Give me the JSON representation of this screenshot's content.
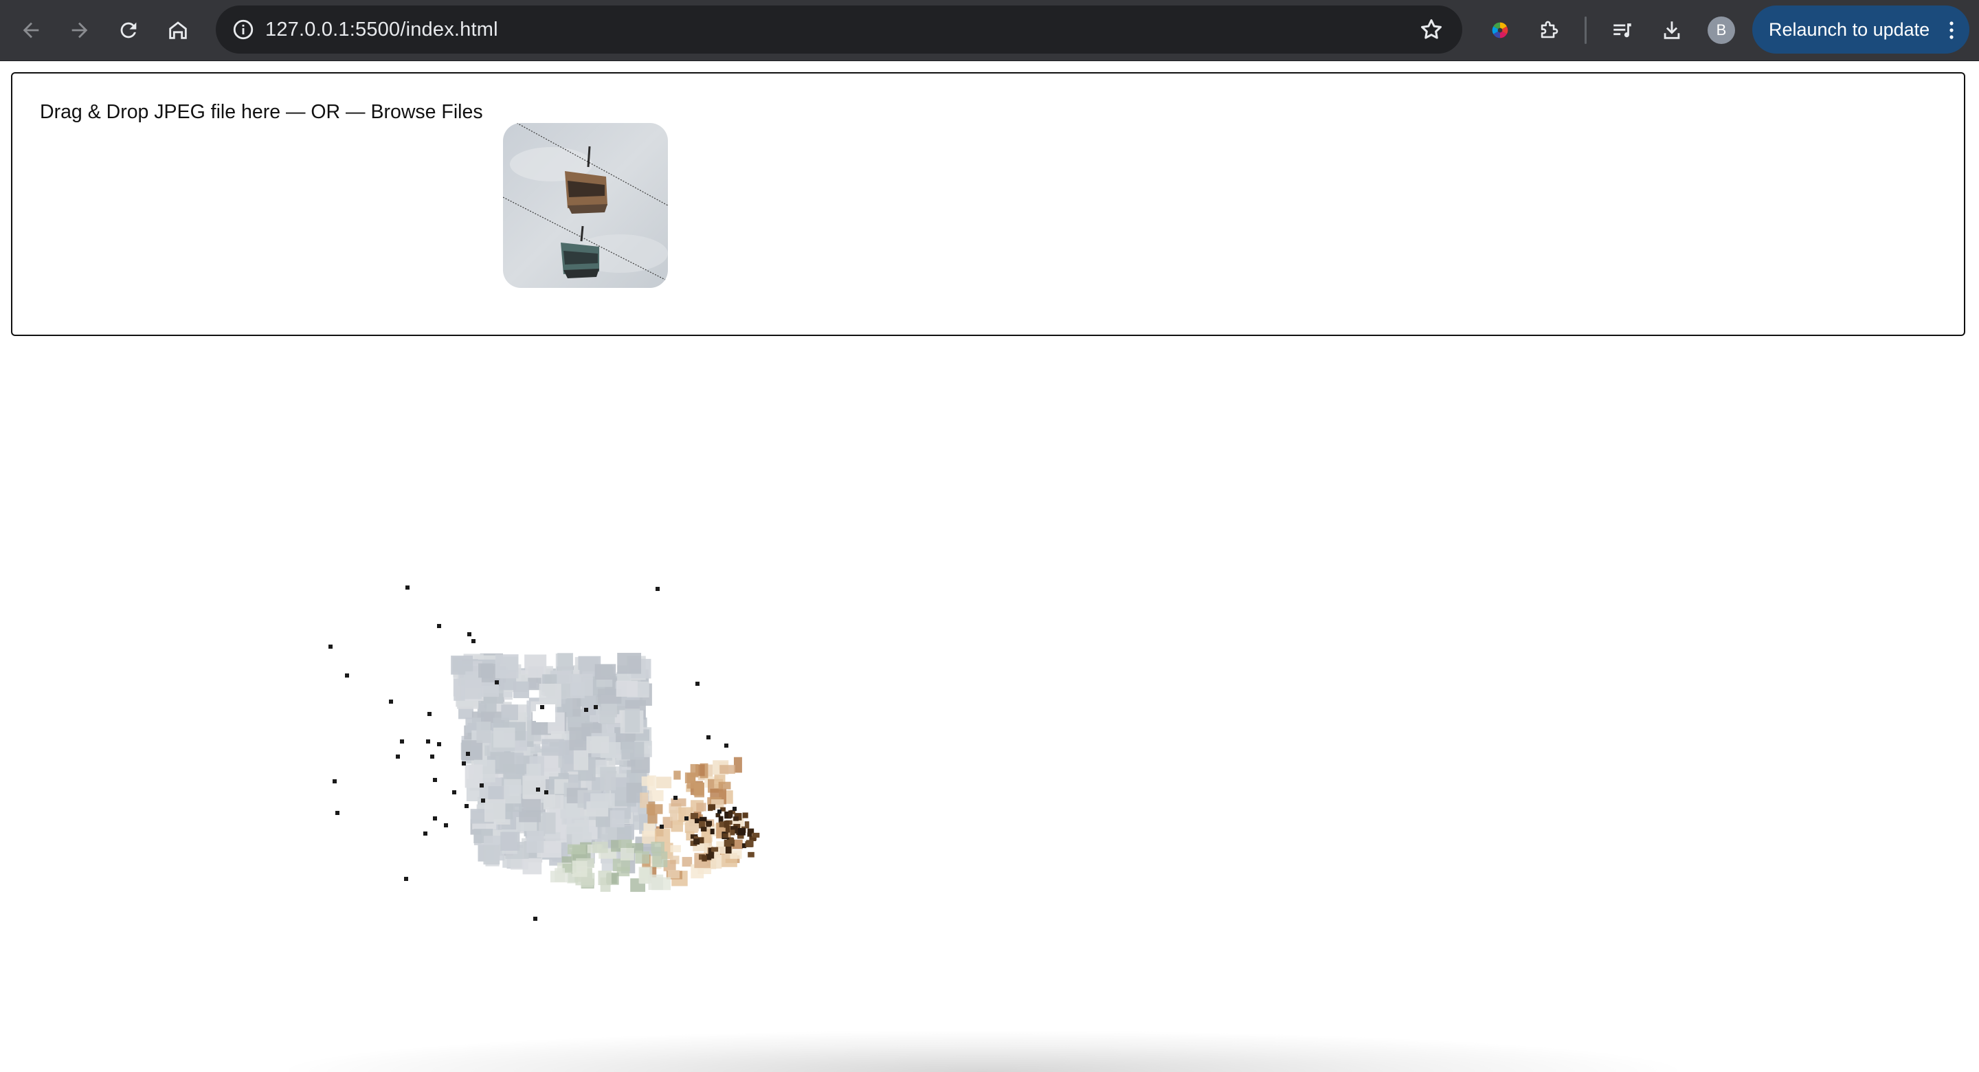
{
  "browser": {
    "url": "127.0.0.1:5500/index.html",
    "relaunch_label": "Relaunch to update",
    "profile_initial": "B",
    "icons": [
      "back-arrow-icon",
      "forward-arrow-icon",
      "reload-icon",
      "home-icon",
      "site-info-icon",
      "bookmark-star-icon",
      "color-wheel-extension-icon",
      "extensions-puzzle-icon",
      "media-queue-icon",
      "download-icon",
      "kebab-menu-icon"
    ],
    "colors": {
      "toolbar": "#35363a",
      "omnibox": "#202124",
      "relaunch": "#1b4b7c"
    }
  },
  "page": {
    "drop_text": "Drag & Drop JPEG file here — OR — Browse Files",
    "preview_alt": "cable-car-photo-thumbnail"
  }
}
